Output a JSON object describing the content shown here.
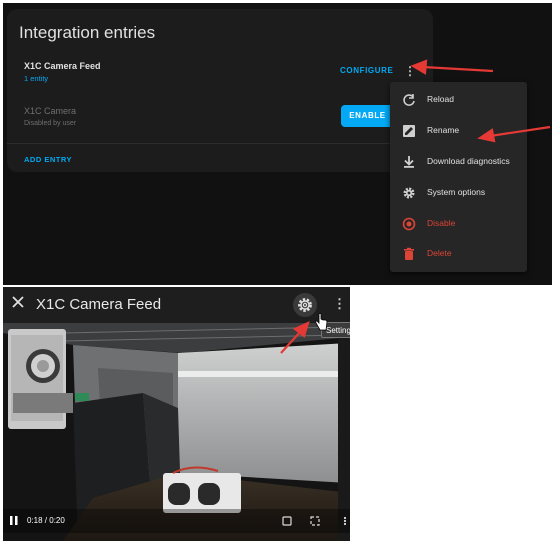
{
  "integration": {
    "title": "Integration entries",
    "entry1": {
      "name": "X1C Camera Feed",
      "sub": "1 entity",
      "configure_label": "CONFIGURE"
    },
    "entry2": {
      "name": "X1C Camera",
      "sub": "Disabled by user",
      "enable_label": "ENABLE"
    },
    "add_entry_label": "ADD ENTRY"
  },
  "menu": {
    "items": [
      {
        "label": "Reload",
        "icon": "reload-icon"
      },
      {
        "label": "Rename",
        "icon": "rename-icon"
      },
      {
        "label": "Download diagnostics",
        "icon": "download-icon"
      },
      {
        "label": "System options",
        "icon": "gear-icon"
      },
      {
        "label": "Disable",
        "icon": "disable-icon"
      },
      {
        "label": "Delete",
        "icon": "trash-icon"
      }
    ]
  },
  "dialog": {
    "title": "X1C Camera Feed",
    "tooltip": "Settings",
    "video_time": "0:18 / 0:20",
    "video_progress": 0.9
  },
  "colors": {
    "accent": "#03a9f4",
    "danger": "#db4437",
    "annotation_arrow": "#e53935"
  }
}
